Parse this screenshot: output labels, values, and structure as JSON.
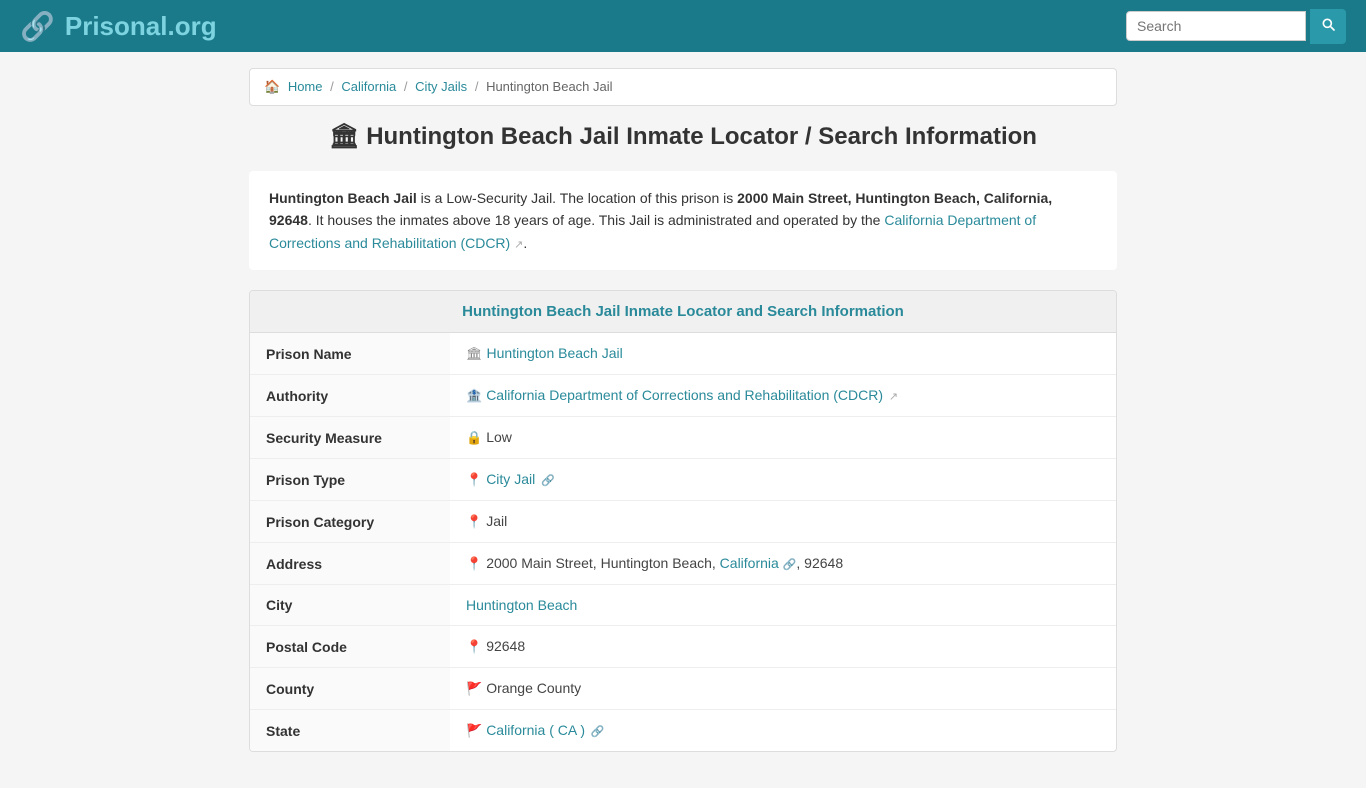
{
  "header": {
    "logo_main": "Prisonal",
    "logo_ext": ".org",
    "search_placeholder": "Search",
    "search_button_icon": "🔍"
  },
  "breadcrumb": {
    "home": "Home",
    "california": "California",
    "city_jails": "City Jails",
    "current": "Huntington Beach Jail"
  },
  "page": {
    "title_icon": "🏛",
    "title": "Huntington Beach Jail Inmate Locator / Search Information"
  },
  "description": {
    "jail_name": "Huntington Beach Jail",
    "intro": " is a Low-Security Jail. The location of this prison is ",
    "address_bold": "2000 Main Street, Huntington Beach, California, 92648",
    "after_address": ". It houses the inmates above 18 years of age. This Jail is administrated and operated by the ",
    "authority_link": "California Department of Corrections and Rehabilitation (CDCR)",
    "period": "."
  },
  "info_section": {
    "header": "Huntington Beach Jail Inmate Locator and Search Information",
    "rows": [
      {
        "label": "Prison Name",
        "icon": "🏛",
        "value": "Huntington Beach Jail",
        "link": true,
        "link_icon": ""
      },
      {
        "label": "Authority",
        "icon": "🏦",
        "value": "California Department of Corrections and Rehabilitation (CDCR)",
        "link": true,
        "link_icon": "↗"
      },
      {
        "label": "Security Measure",
        "icon": "🔒",
        "value": "Low",
        "link": false,
        "link_icon": ""
      },
      {
        "label": "Prison Type",
        "icon": "📍",
        "value": "City Jail",
        "link": true,
        "link_icon": "🔗"
      },
      {
        "label": "Prison Category",
        "icon": "📍",
        "value": "Jail",
        "link": false,
        "link_icon": ""
      },
      {
        "label": "Address",
        "icon": "📍",
        "value": "2000 Main Street, Huntington Beach, California",
        "state_link": "California",
        "value_suffix": ", 92648",
        "link": false,
        "link_icon": "🔗"
      },
      {
        "label": "City",
        "icon": "",
        "value": "Huntington Beach",
        "link": true,
        "link_icon": ""
      },
      {
        "label": "Postal Code",
        "icon": "📍",
        "value": "92648",
        "link": false,
        "link_icon": ""
      },
      {
        "label": "County",
        "icon": "🚩",
        "value": "Orange County",
        "link": false,
        "link_icon": ""
      },
      {
        "label": "State",
        "icon": "🚩",
        "value": "California ( CA )",
        "link": true,
        "link_icon": "🔗"
      }
    ]
  }
}
